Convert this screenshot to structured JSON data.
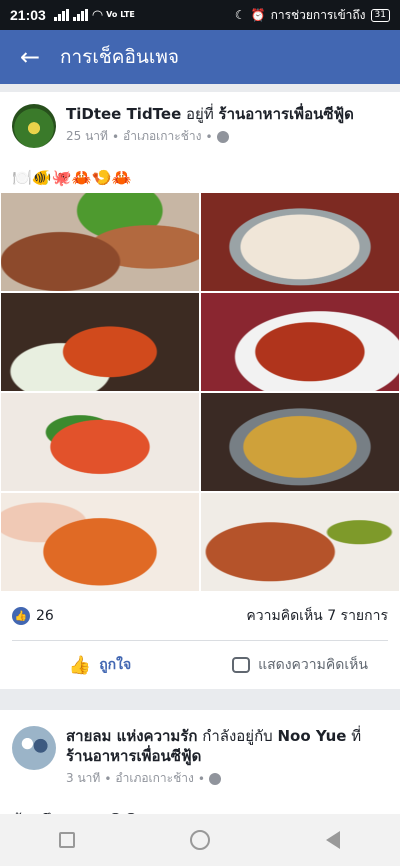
{
  "status_bar": {
    "time": "21:03",
    "network": "Vo LTE",
    "right_text": "การช่วยการเข้าถึง",
    "battery": "31"
  },
  "app_bar": {
    "title": "การเช็คอินเพจ",
    "back_icon": "arrow-left-icon"
  },
  "post1": {
    "author": "TiDtee TidTee",
    "at_word": "อยู่ที่",
    "place": "ร้านอาหารเพื่อนซีฟู้ด",
    "time": "25 นาที",
    "location": "อำเภอเกาะช้าง",
    "emoji": "🍽️🐠🐙🦀🍤🦀",
    "photos": [
      "shellfish-platter",
      "seafood-soup",
      "stir-fried-shellfish",
      "fried-fish-chili",
      "spicy-prawns",
      "seafood-tom-yum",
      "chili-stir-fry",
      "grilled-prawns"
    ],
    "likes": "26",
    "comments": "ความคิดเห็น 7 รายการ",
    "like_label": "ถูกใจ",
    "comment_label": "แสดงความคิดเห็น"
  },
  "post2": {
    "author": "สายลม แห่งความรัก",
    "with_word": "กำลังอยู่กับ",
    "with_name": "Noo Yue",
    "at_word": "ที่",
    "place": "ร้านอาหารเพื่อนซีฟู้ด",
    "time": "3 นาที",
    "location": "อำเภอเกาะช้าง",
    "partial_text": "ม้วนซึมนะแบบ😊😊"
  },
  "colors": {
    "brand": "#4267b2",
    "status_bar": "#12161b"
  }
}
